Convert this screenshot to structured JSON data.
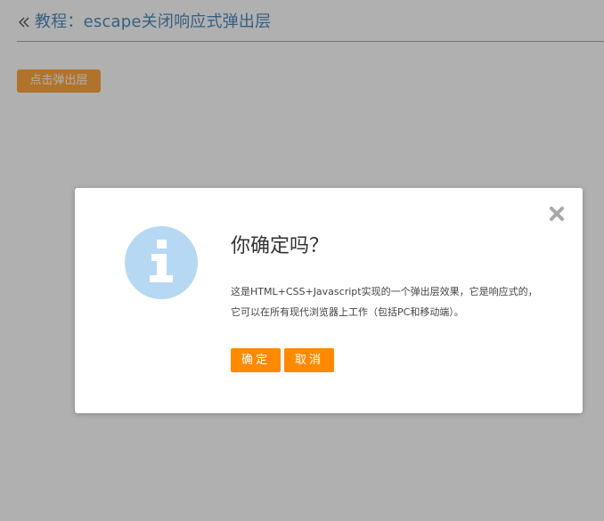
{
  "header": {
    "back_icon": "double-chevron-left-icon",
    "title": "教程：escape关闭响应式弹出层"
  },
  "main": {
    "open_button_label": "点击弹出层"
  },
  "dialog": {
    "close_icon": "close-x-icon",
    "info_icon": "info-icon",
    "title": "你确定吗？",
    "message": "这是HTML+CSS+Javascript实现的一个弹出层效果，它是响应式的，它可以在所有现代浏览器上工作（包括PC和移动端）。",
    "confirm_label": "确定",
    "cancel_label": "取消"
  },
  "colors": {
    "accent": "#ff8a00",
    "title_link": "#1565a8",
    "overlay": "#5a5a5a",
    "info_icon_bg": "#b7d8f3"
  }
}
